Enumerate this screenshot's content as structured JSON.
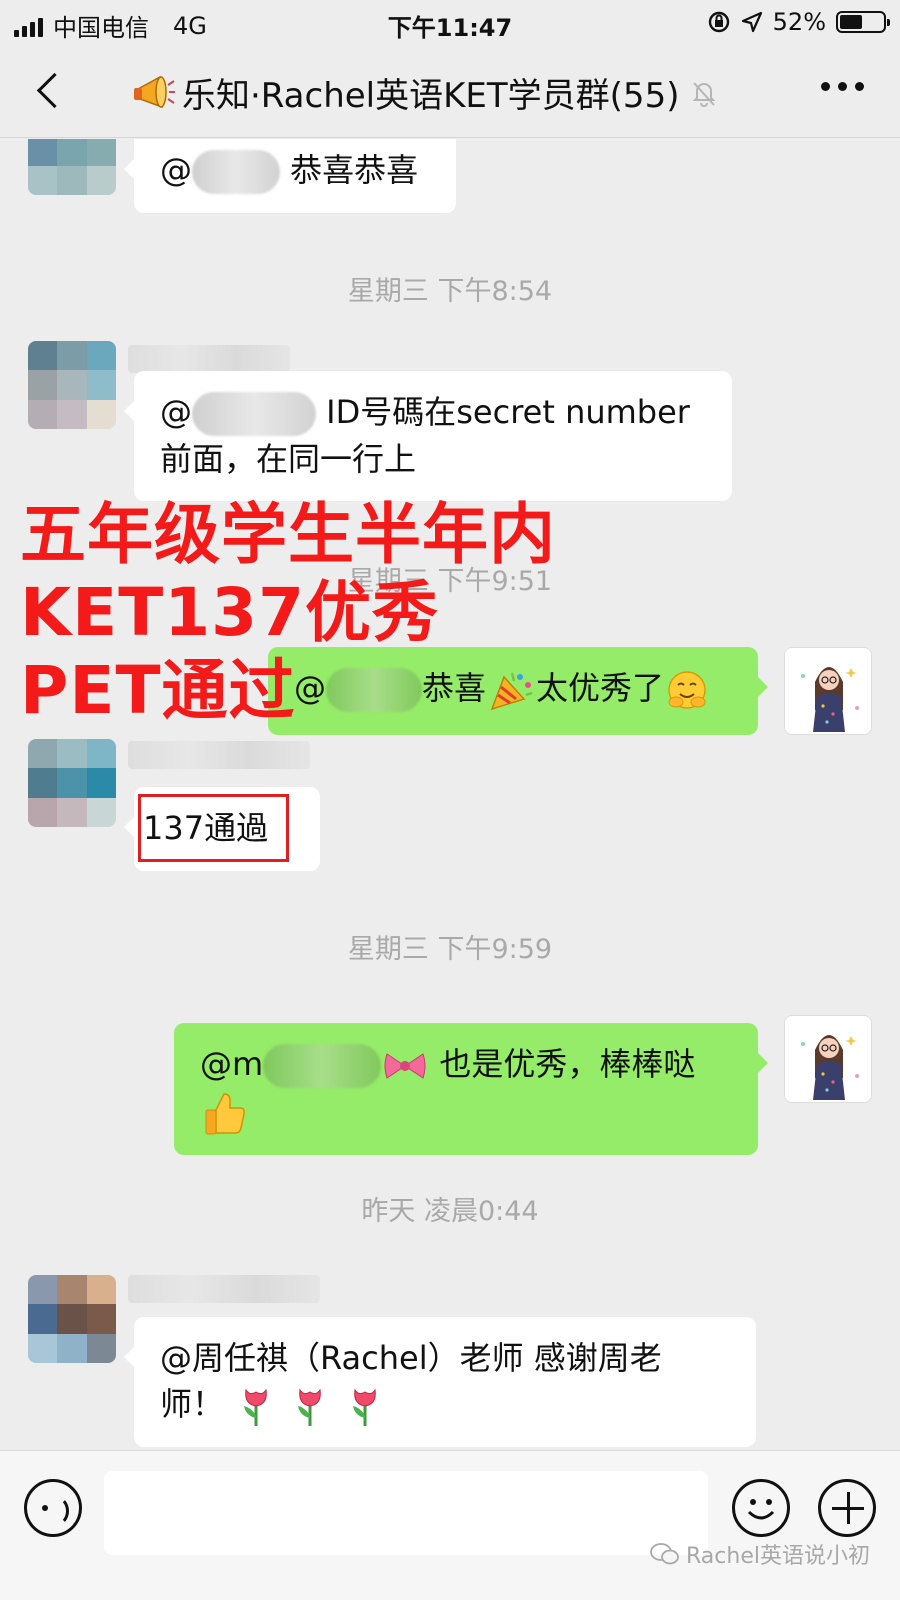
{
  "status_bar": {
    "carrier": "中国电信",
    "network": "4G",
    "time": "下午11:47",
    "battery": "52%",
    "battery_level": 0.52
  },
  "nav": {
    "title": "乐知·Rachel英语KET学员群(55)",
    "back_icon": "back-chevron-icon",
    "more_icon": "more-dots-icon",
    "mute_icon": "mute-bell-icon"
  },
  "messages": [
    {
      "side": "left",
      "text_prefix": "@",
      "text": "恭喜恭喜"
    },
    {
      "time": "星期三 下午8:54"
    },
    {
      "side": "left",
      "text_prefix": "@",
      "line1": "ID号碼在secret number",
      "line2": "前面，在同一行上"
    },
    {
      "time": "星期三 下午9:51"
    },
    {
      "side": "right",
      "text_prefix": "@",
      "text_a": "恭喜",
      "text_b": "太优秀了"
    },
    {
      "side": "left",
      "text": "137通過"
    },
    {
      "time": "星期三 下午9:59"
    },
    {
      "side": "right",
      "text_prefix": "@m",
      "text": "也是优秀，棒棒哒"
    },
    {
      "time": "昨天 凌晨0:44"
    },
    {
      "side": "left",
      "line1": "@周任祺（Rachel）老师 感谢周老",
      "line2": "师！"
    }
  ],
  "overlay": {
    "line1": "五年级学生半年内",
    "line2": "KET137优秀",
    "line3": "PET通过",
    "color": "#f41a1a"
  },
  "input_bar": {
    "voice_icon": "voice-icon",
    "emoji_icon": "emoji-smile-icon",
    "plus_icon": "plus-circle-icon"
  },
  "watermark": "Rachel英语说小初",
  "colors": {
    "background": "#ededed",
    "bubble_self": "#95ec69",
    "bubble_other": "#ffffff",
    "timestamp": "#a9a9a9"
  }
}
